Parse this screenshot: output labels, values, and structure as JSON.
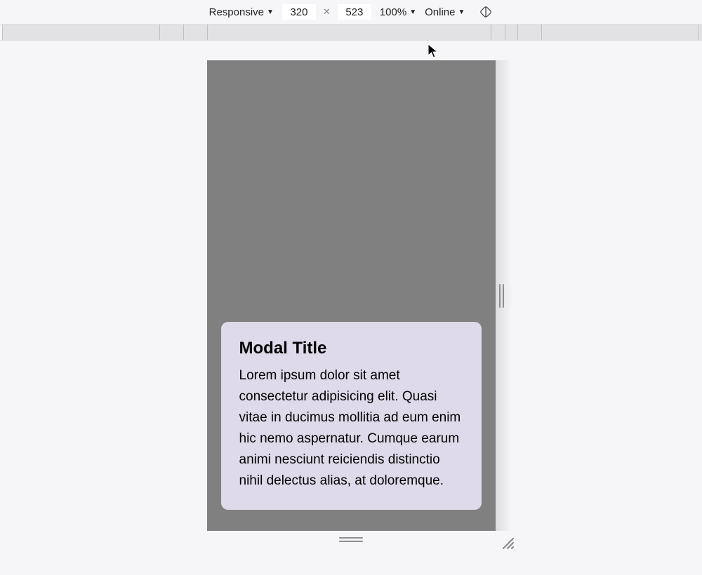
{
  "toolbar": {
    "device_label": "Responsive",
    "width": "320",
    "height": "523",
    "zoom": "100%",
    "network": "Online"
  },
  "modal": {
    "title": "Modal Title",
    "body": "Lorem ipsum dolor sit amet consectetur adipisicing elit. Quasi vitae in ducimus mollitia ad eum enim hic nemo aspernatur. Cumque earum animi nesciunt reiciendis distinctio nihil delectus alias, at doloremque."
  }
}
